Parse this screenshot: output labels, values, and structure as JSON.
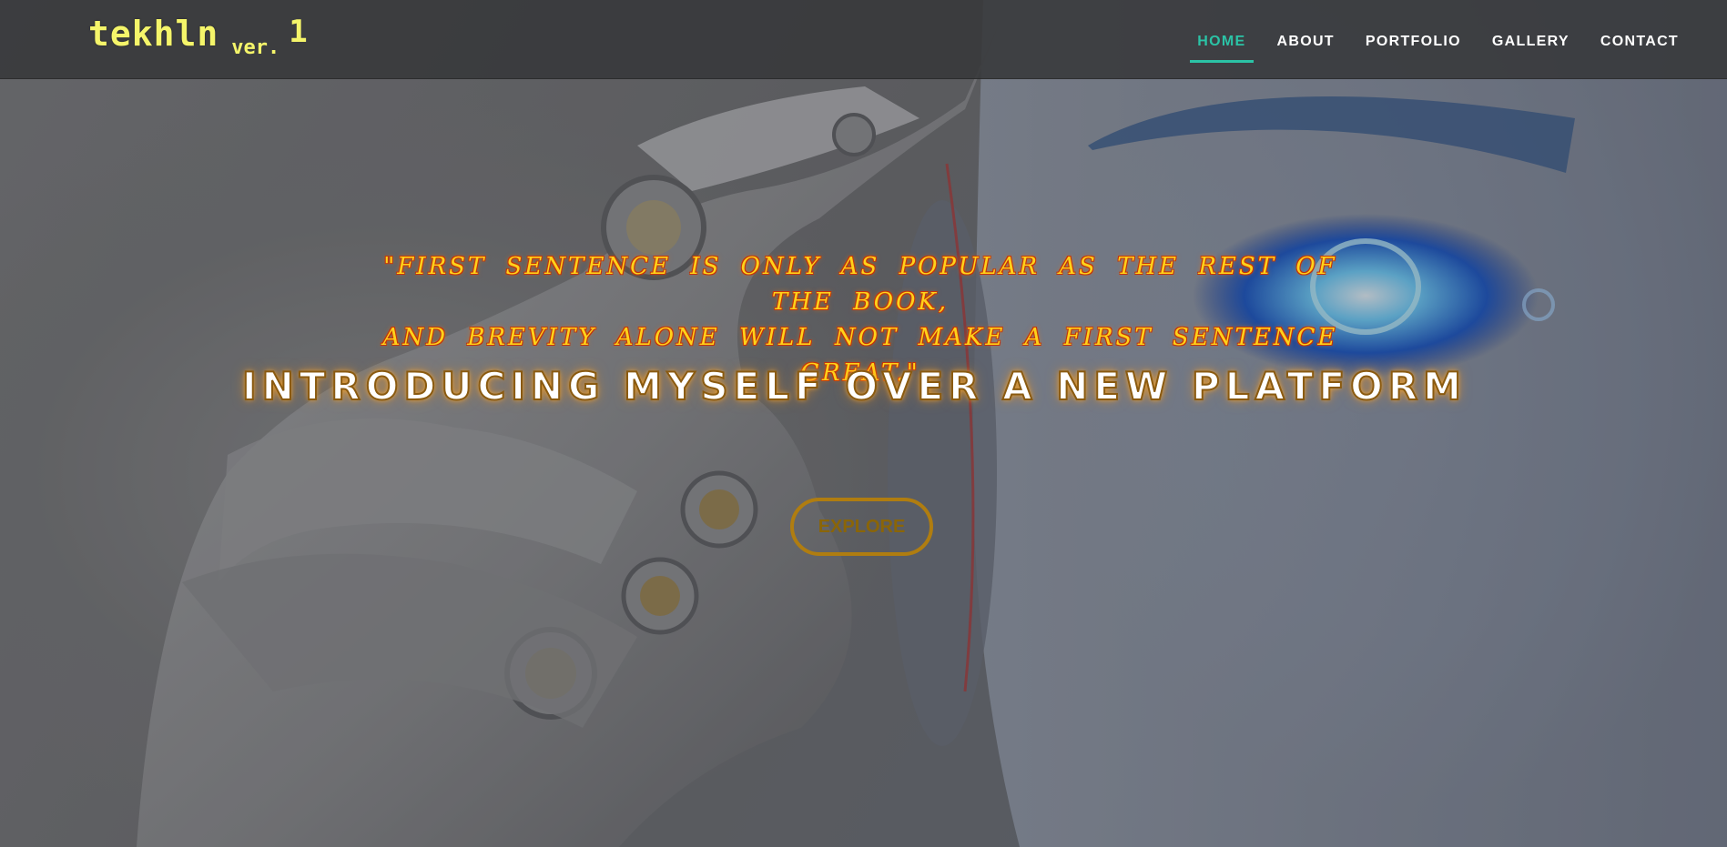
{
  "brand": {
    "name": "tekhln",
    "version_prefix": "ver.",
    "version_number": "1"
  },
  "nav": {
    "items": [
      {
        "label": "HOME",
        "active": true
      },
      {
        "label": "ABOUT",
        "active": false
      },
      {
        "label": "PORTFOLIO",
        "active": false
      },
      {
        "label": "GALLERY",
        "active": false
      },
      {
        "label": "CONTACT",
        "active": false
      }
    ]
  },
  "hero": {
    "quote_line_1": "\"First sentence is only as popular as the rest of the book,",
    "quote_line_2": "and brevity alone will not make a first sentence great.\"",
    "headline": "INTRODUCING MYSELF OVER A NEW PLATFORM",
    "button_label": "EXPLORE"
  },
  "colors": {
    "brand": "#f5f56a",
    "nav_active": "#2bc3a6",
    "quote": "#ffd21a",
    "button_border": "#b07d10"
  }
}
